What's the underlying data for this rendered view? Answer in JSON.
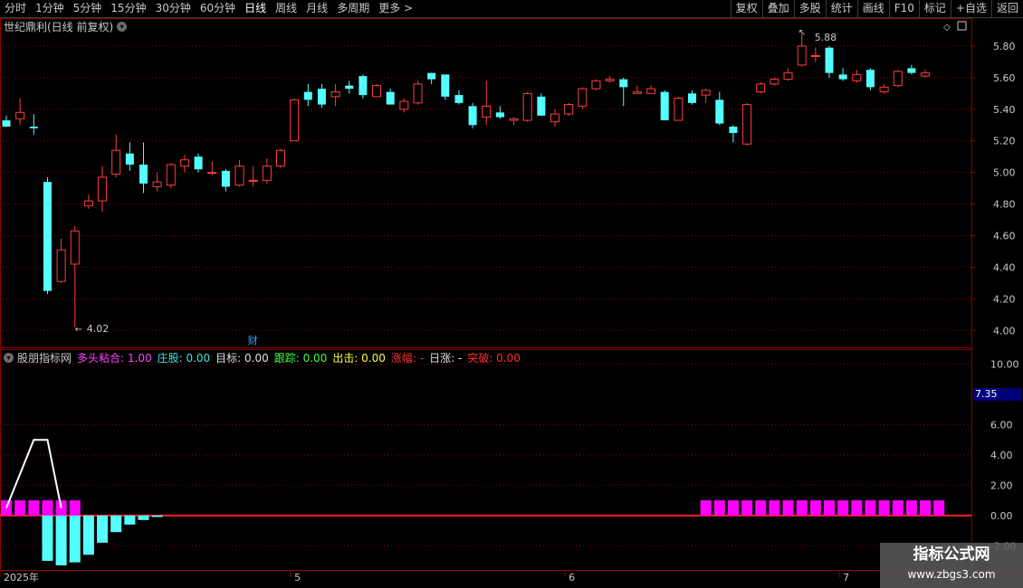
{
  "toolbar": {
    "periods": [
      "分时",
      "1分钟",
      "5分钟",
      "15分钟",
      "30分钟",
      "60分钟",
      "日线",
      "周线",
      "月线",
      "多周期",
      "更多 >"
    ],
    "active_period": "日线",
    "buttons": [
      "复权",
      "叠加",
      "多股",
      "统计",
      "画线",
      "F10",
      "标记",
      "+自选",
      "返回"
    ]
  },
  "main_chart": {
    "title": "世纪鼎利(日线 前复权)",
    "price_axis": [
      "5.80",
      "5.60",
      "5.40",
      "5.20",
      "5.00",
      "4.80",
      "4.60",
      "4.40",
      "4.20",
      "4.00"
    ],
    "high_label": "5.88",
    "low_label": "4.02",
    "marker": "财"
  },
  "indicator": {
    "name": "股朋指标网",
    "fields": [
      {
        "label": "多头粘合:",
        "value": "1.00",
        "color": "#ff40ff"
      },
      {
        "label": "庄股:",
        "value": "0.00",
        "color": "#40e0e0"
      },
      {
        "label": "目标:",
        "value": "0.00",
        "color": "#e0e0e0"
      },
      {
        "label": "跟踪:",
        "value": "0.00",
        "color": "#40ff40"
      },
      {
        "label": "出击:",
        "value": "0.00",
        "color": "#ffff40"
      },
      {
        "label": "涨幅:",
        "value": "-",
        "color": "#ff3030"
      },
      {
        "label": "日涨:",
        "value": "-",
        "color": "#e0e0e0"
      },
      {
        "label": "突破:",
        "value": "0.00",
        "color": "#ff3030"
      }
    ],
    "axis": [
      "10.00",
      "6.00",
      "4.00",
      "2.00",
      "0.00",
      "-2.00"
    ],
    "current_value": "7.35"
  },
  "time_axis": [
    "2025年",
    "5",
    "6",
    "7"
  ],
  "watermark": {
    "line1": "指标公式网",
    "line2": "www.zbgs3.com"
  },
  "colors": {
    "up": "#ff3c3c",
    "down": "#54ffff",
    "magenta": "#ff00ff",
    "grid": "#8b0000"
  },
  "chart_data": {
    "type": "candlestick",
    "ylim": [
      3.95,
      5.92
    ],
    "candles": [
      {
        "o": 5.33,
        "c": 5.29,
        "h": 5.36,
        "l": 5.29
      },
      {
        "o": 5.34,
        "c": 5.38,
        "h": 5.47,
        "l": 5.3
      },
      {
        "o": 5.29,
        "c": 5.28,
        "h": 5.37,
        "l": 5.24
      },
      {
        "o": 4.94,
        "c": 4.25,
        "h": 4.97,
        "l": 4.23
      },
      {
        "o": 4.31,
        "c": 4.51,
        "h": 4.58,
        "l": 4.3
      },
      {
        "o": 4.42,
        "c": 4.63,
        "h": 4.66,
        "l": 4.02
      },
      {
        "o": 4.79,
        "c": 4.82,
        "h": 4.86,
        "l": 4.77
      },
      {
        "o": 4.82,
        "c": 4.97,
        "h": 5.04,
        "l": 4.75
      },
      {
        "o": 4.99,
        "c": 5.14,
        "h": 5.24,
        "l": 4.97
      },
      {
        "o": 5.12,
        "c": 5.05,
        "h": 5.19,
        "l": 5.01
      },
      {
        "o": 5.05,
        "c": 4.93,
        "h": 5.19,
        "l": 4.87
      },
      {
        "o": 4.91,
        "c": 4.94,
        "h": 5.0,
        "l": 4.88
      },
      {
        "o": 4.92,
        "c": 5.05,
        "h": 5.06,
        "l": 4.9
      },
      {
        "o": 5.04,
        "c": 5.08,
        "h": 5.11,
        "l": 5.0
      },
      {
        "o": 5.1,
        "c": 5.02,
        "h": 5.12,
        "l": 5.0
      },
      {
        "o": 5.0,
        "c": 5.0,
        "h": 5.07,
        "l": 4.98
      },
      {
        "o": 5.01,
        "c": 4.91,
        "h": 5.02,
        "l": 4.88
      },
      {
        "o": 4.92,
        "c": 5.04,
        "h": 5.08,
        "l": 4.91
      },
      {
        "o": 4.95,
        "c": 4.95,
        "h": 5.04,
        "l": 4.91
      },
      {
        "o": 4.95,
        "c": 5.04,
        "h": 5.09,
        "l": 4.93
      },
      {
        "o": 5.04,
        "c": 5.14,
        "h": 5.15,
        "l": 5.03
      },
      {
        "o": 5.2,
        "c": 5.46,
        "h": 5.47,
        "l": 5.2
      },
      {
        "o": 5.51,
        "c": 5.46,
        "h": 5.56,
        "l": 5.42
      },
      {
        "o": 5.53,
        "c": 5.43,
        "h": 5.56,
        "l": 5.41
      },
      {
        "o": 5.48,
        "c": 5.51,
        "h": 5.56,
        "l": 5.42
      },
      {
        "o": 5.55,
        "c": 5.53,
        "h": 5.58,
        "l": 5.5
      },
      {
        "o": 5.61,
        "c": 5.49,
        "h": 5.62,
        "l": 5.47
      },
      {
        "o": 5.48,
        "c": 5.55,
        "h": 5.56,
        "l": 5.48
      },
      {
        "o": 5.51,
        "c": 5.43,
        "h": 5.53,
        "l": 5.43
      },
      {
        "o": 5.4,
        "c": 5.45,
        "h": 5.47,
        "l": 5.38
      },
      {
        "o": 5.44,
        "c": 5.56,
        "h": 5.58,
        "l": 5.43
      },
      {
        "o": 5.63,
        "c": 5.59,
        "h": 5.63,
        "l": 5.56
      },
      {
        "o": 5.62,
        "c": 5.48,
        "h": 5.62,
        "l": 5.46
      },
      {
        "o": 5.49,
        "c": 5.44,
        "h": 5.52,
        "l": 5.43
      },
      {
        "o": 5.42,
        "c": 5.3,
        "h": 5.44,
        "l": 5.28
      },
      {
        "o": 5.35,
        "c": 5.42,
        "h": 5.58,
        "l": 5.3
      },
      {
        "o": 5.38,
        "c": 5.35,
        "h": 5.42,
        "l": 5.34
      },
      {
        "o": 5.33,
        "c": 5.34,
        "h": 5.35,
        "l": 5.3
      },
      {
        "o": 5.33,
        "c": 5.5,
        "h": 5.51,
        "l": 5.32
      },
      {
        "o": 5.48,
        "c": 5.36,
        "h": 5.5,
        "l": 5.36
      },
      {
        "o": 5.32,
        "c": 5.37,
        "h": 5.4,
        "l": 5.29
      },
      {
        "o": 5.37,
        "c": 5.43,
        "h": 5.44,
        "l": 5.36
      },
      {
        "o": 5.42,
        "c": 5.53,
        "h": 5.54,
        "l": 5.4
      },
      {
        "o": 5.53,
        "c": 5.58,
        "h": 5.59,
        "l": 5.52
      },
      {
        "o": 5.58,
        "c": 5.59,
        "h": 5.61,
        "l": 5.57
      },
      {
        "o": 5.59,
        "c": 5.54,
        "h": 5.6,
        "l": 5.42
      },
      {
        "o": 5.5,
        "c": 5.51,
        "h": 5.55,
        "l": 5.5
      },
      {
        "o": 5.5,
        "c": 5.53,
        "h": 5.55,
        "l": 5.5
      },
      {
        "o": 5.51,
        "c": 5.33,
        "h": 5.52,
        "l": 5.33
      },
      {
        "o": 5.33,
        "c": 5.47,
        "h": 5.48,
        "l": 5.33
      },
      {
        "o": 5.5,
        "c": 5.44,
        "h": 5.52,
        "l": 5.43
      },
      {
        "o": 5.49,
        "c": 5.52,
        "h": 5.53,
        "l": 5.44
      },
      {
        "o": 5.46,
        "c": 5.31,
        "h": 5.51,
        "l": 5.3
      },
      {
        "o": 5.29,
        "c": 5.25,
        "h": 5.3,
        "l": 5.19
      },
      {
        "o": 5.18,
        "c": 5.43,
        "h": 5.44,
        "l": 5.17
      },
      {
        "o": 5.51,
        "c": 5.56,
        "h": 5.57,
        "l": 5.5
      },
      {
        "o": 5.56,
        "c": 5.59,
        "h": 5.6,
        "l": 5.55
      },
      {
        "o": 5.59,
        "c": 5.63,
        "h": 5.66,
        "l": 5.58
      },
      {
        "o": 5.68,
        "c": 5.8,
        "h": 5.88,
        "l": 5.67
      },
      {
        "o": 5.74,
        "c": 5.74,
        "h": 5.79,
        "l": 5.7
      },
      {
        "o": 5.79,
        "c": 5.63,
        "h": 5.8,
        "l": 5.6
      },
      {
        "o": 5.62,
        "c": 5.59,
        "h": 5.66,
        "l": 5.58
      },
      {
        "o": 5.58,
        "c": 5.62,
        "h": 5.65,
        "l": 5.57
      },
      {
        "o": 5.65,
        "c": 5.54,
        "h": 5.66,
        "l": 5.52
      },
      {
        "o": 5.51,
        "c": 5.54,
        "h": 5.56,
        "l": 5.5
      },
      {
        "o": 5.55,
        "c": 5.64,
        "h": 5.65,
        "l": 5.54
      },
      {
        "o": 5.66,
        "c": 5.63,
        "h": 5.68,
        "l": 5.62
      },
      {
        "o": 5.61,
        "c": 5.63,
        "h": 5.65,
        "l": 5.6
      }
    ],
    "indicator_ylim": [
      -3.6,
      11.0
    ],
    "cyan_bars": [
      0,
      0,
      0,
      -3.0,
      -3.3,
      -3.1,
      -2.6,
      -1.8,
      -1.1,
      -0.6,
      -0.3,
      -0.1
    ],
    "magenta_blocks_index": [
      0,
      1,
      2,
      3,
      4,
      5,
      51,
      52,
      53,
      54,
      55,
      56,
      57,
      58,
      59,
      60,
      61,
      62,
      63,
      64,
      65,
      66,
      67,
      68
    ],
    "white_line": [
      [
        0,
        0.5
      ],
      [
        2,
        5
      ],
      [
        3,
        5
      ],
      [
        4,
        0.5
      ]
    ]
  }
}
